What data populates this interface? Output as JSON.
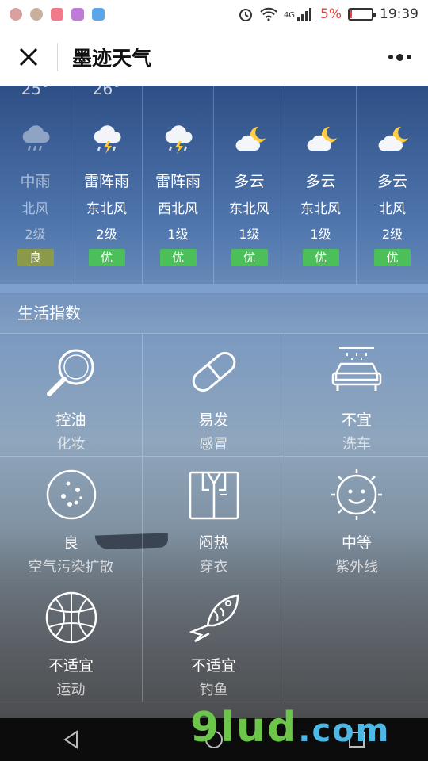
{
  "status_bar": {
    "network": "4G",
    "battery_percent": "5%",
    "battery_level": 0.05,
    "time": "19:39",
    "accent_color": "#e94040"
  },
  "nav": {
    "title": "墨迹天气",
    "close_icon": "close-icon",
    "more_icon": "more-icon"
  },
  "forecast": [
    {
      "temp": "25°",
      "condition": "中雨",
      "icon": "rain-icon",
      "wind_dir": "北风",
      "wind_level": "2级",
      "aqi": "良",
      "aqi_color": "#8a9a4a",
      "dim": true
    },
    {
      "temp": "26°",
      "condition": "雷阵雨",
      "icon": "thunderstorm-icon",
      "wind_dir": "东北风",
      "wind_level": "2级",
      "aqi": "优",
      "aqi_color": "#4cbf5b",
      "dim": false
    },
    {
      "temp": "",
      "condition": "雷阵雨",
      "icon": "thunderstorm-icon",
      "wind_dir": "西北风",
      "wind_level": "1级",
      "aqi": "优",
      "aqi_color": "#4cbf5b",
      "dim": false
    },
    {
      "temp": "",
      "condition": "多云",
      "icon": "partly-cloudy-night-icon",
      "wind_dir": "东北风",
      "wind_level": "1级",
      "aqi": "优",
      "aqi_color": "#4cbf5b",
      "dim": false
    },
    {
      "temp": "",
      "condition": "多云",
      "icon": "partly-cloudy-night-icon",
      "wind_dir": "东北风",
      "wind_level": "1级",
      "aqi": "优",
      "aqi_color": "#4cbf5b",
      "dim": false
    },
    {
      "temp": "",
      "condition": "多云",
      "icon": "partly-cloudy-night-icon",
      "wind_dir": "北风",
      "wind_level": "2级",
      "aqi": "优",
      "aqi_color": "#4cbf5b",
      "dim": false
    }
  ],
  "life_index": {
    "title": "生活指数",
    "items": [
      {
        "icon": "magnifier-icon",
        "value": "控油",
        "label": "化妆"
      },
      {
        "icon": "pill-icon",
        "value": "易发",
        "label": "感冒"
      },
      {
        "icon": "car-wash-icon",
        "value": "不宜",
        "label": "洗车"
      },
      {
        "icon": "air-particles-icon",
        "value": "良",
        "label": "空气污染扩散"
      },
      {
        "icon": "shirt-icon",
        "value": "闷热",
        "label": "穿衣"
      },
      {
        "icon": "smiley-sun-icon",
        "value": "中等",
        "label": "紫外线"
      },
      {
        "icon": "basketball-icon",
        "value": "不适宜",
        "label": "运动"
      },
      {
        "icon": "fish-icon",
        "value": "不适宜",
        "label": "钓鱼"
      }
    ]
  },
  "watermark": {
    "text": "9lud",
    "suffix": ".com"
  }
}
